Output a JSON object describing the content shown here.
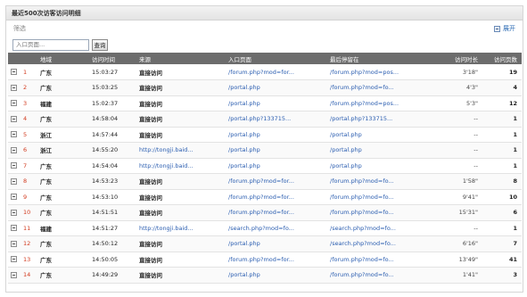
{
  "panel": {
    "title": "最近500次访客访问明细",
    "filter_label": "筛选",
    "expand_label": "展开",
    "search_placeholder": "入口页面...",
    "search_button": "查询"
  },
  "table": {
    "headers": [
      "",
      "",
      "地域",
      "访问时间",
      "来源",
      "入口页面",
      "最后停留在",
      "访问时长",
      "访问页数"
    ],
    "rows": [
      {
        "idx": "1",
        "region": "广东",
        "time": "15:03:27",
        "source": "直接访问",
        "source_link": false,
        "entry": "/forum.php?mod=for...",
        "last": "/forum.php?mod=pos...",
        "duration": "3'18\"",
        "pages": "19"
      },
      {
        "idx": "2",
        "region": "广东",
        "time": "15:03:25",
        "source": "直接访问",
        "source_link": false,
        "entry": "/portal.php",
        "last": "/forum.php?mod=fo...",
        "duration": "4'3\"",
        "pages": "4"
      },
      {
        "idx": "3",
        "region": "福建",
        "time": "15:02:37",
        "source": "直接访问",
        "source_link": false,
        "entry": "/portal.php",
        "last": "/forum.php?mod=pos...",
        "duration": "5'3\"",
        "pages": "12"
      },
      {
        "idx": "4",
        "region": "广东",
        "time": "14:58:04",
        "source": "直接访问",
        "source_link": false,
        "entry": "/portal.php?133715...",
        "last": "/portal.php?133715...",
        "duration": "--",
        "pages": "1"
      },
      {
        "idx": "5",
        "region": "浙江",
        "time": "14:57:44",
        "source": "直接访问",
        "source_link": false,
        "entry": "/portal.php",
        "last": "/portal.php",
        "duration": "--",
        "pages": "1"
      },
      {
        "idx": "6",
        "region": "浙江",
        "time": "14:55:20",
        "source": "http://tongji.baid...",
        "source_link": true,
        "entry": "/portal.php",
        "last": "/portal.php",
        "duration": "--",
        "pages": "1"
      },
      {
        "idx": "7",
        "region": "广东",
        "time": "14:54:04",
        "source": "http://tongji.baid...",
        "source_link": true,
        "entry": "/portal.php",
        "last": "/portal.php",
        "duration": "--",
        "pages": "1"
      },
      {
        "idx": "8",
        "region": "广东",
        "time": "14:53:23",
        "source": "直接访问",
        "source_link": false,
        "entry": "/forum.php?mod=for...",
        "last": "/forum.php?mod=fo...",
        "duration": "1'58\"",
        "pages": "8"
      },
      {
        "idx": "9",
        "region": "广东",
        "time": "14:53:10",
        "source": "直接访问",
        "source_link": false,
        "entry": "/forum.php?mod=for...",
        "last": "/forum.php?mod=fo...",
        "duration": "9'41\"",
        "pages": "10"
      },
      {
        "idx": "10",
        "region": "广东",
        "time": "14:51:51",
        "source": "直接访问",
        "source_link": false,
        "entry": "/forum.php?mod=for...",
        "last": "/forum.php?mod=fo...",
        "duration": "15'31\"",
        "pages": "6"
      },
      {
        "idx": "11",
        "region": "福建",
        "time": "14:51:27",
        "source": "http://tongji.baid...",
        "source_link": true,
        "entry": "/search.php?mod=fo...",
        "last": "/search.php?mod=fo...",
        "duration": "--",
        "pages": "1"
      },
      {
        "idx": "12",
        "region": "广东",
        "time": "14:50:12",
        "source": "直接访问",
        "source_link": false,
        "entry": "/portal.php",
        "last": "/search.php?mod=fo...",
        "duration": "6'16\"",
        "pages": "7"
      },
      {
        "idx": "13",
        "region": "广东",
        "time": "14:50:05",
        "source": "直接访问",
        "source_link": false,
        "entry": "/forum.php?mod=for...",
        "last": "/forum.php?mod=fo...",
        "duration": "13'49\"",
        "pages": "41"
      },
      {
        "idx": "14",
        "region": "广东",
        "time": "14:49:29",
        "source": "直接访问",
        "source_link": false,
        "entry": "/portal.php",
        "last": "/forum.php?mod=fo...",
        "duration": "1'41\"",
        "pages": "3"
      }
    ]
  },
  "colors": {
    "header_bg": "#6c6c6c",
    "index_red": "#d23a1e",
    "link_blue": "#2a5db0"
  }
}
